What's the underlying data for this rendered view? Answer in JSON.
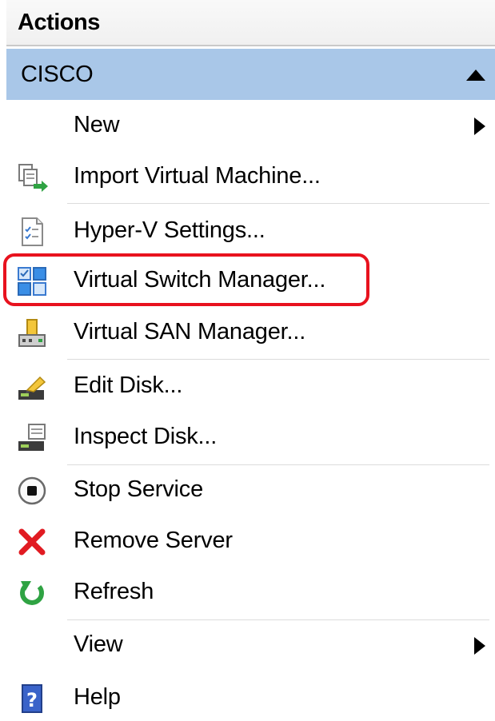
{
  "pane": {
    "title": "Actions"
  },
  "group": {
    "label": "CISCO"
  },
  "items": [
    {
      "label": "New",
      "icon": "none",
      "submenu": true
    },
    {
      "label": "Import Virtual Machine...",
      "icon": "import-vm-icon"
    },
    {
      "label": "Hyper-V Settings...",
      "icon": "settings-document-icon"
    },
    {
      "label": "Virtual Switch Manager...",
      "icon": "virtual-switch-icon",
      "highlighted": true
    },
    {
      "label": "Virtual SAN Manager...",
      "icon": "virtual-san-icon"
    },
    {
      "label": "Edit Disk...",
      "icon": "edit-disk-icon"
    },
    {
      "label": "Inspect Disk...",
      "icon": "inspect-disk-icon"
    },
    {
      "label": "Stop Service",
      "icon": "stop-icon"
    },
    {
      "label": "Remove Server",
      "icon": "red-x-icon"
    },
    {
      "label": "Refresh",
      "icon": "refresh-icon"
    },
    {
      "label": "View",
      "icon": "none",
      "submenu": true
    },
    {
      "label": "Help",
      "icon": "help-icon"
    }
  ],
  "colors": {
    "group_header_bg": "#a9c7e8",
    "highlight_border": "#e8121e",
    "remove_red": "#e11b22",
    "refresh_green": "#2fa343",
    "help_blue": "#3a63c9"
  }
}
